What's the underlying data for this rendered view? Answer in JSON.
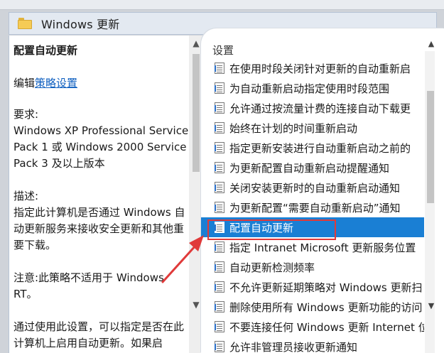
{
  "header": {
    "title": "Windows 更新",
    "folder_icon": "folder-icon"
  },
  "left_pane": {
    "policy_title": "配置自动更新",
    "edit_prefix": "编辑",
    "edit_link": "策略设置",
    "requirements_label": "要求:",
    "requirements_text": "Windows XP Professional Service Pack 1 或 Windows 2000 Service Pack 3 及以上版本",
    "description_label": "描述:",
    "description_text": "指定此计算机是否通过 Windows 自动更新服务来接收安全更新和其他重要下载。",
    "note_text": "注意:此策略不适用于 Windows RT。",
    "usage_text": "通过使用此设置，可以指定是否在此计算机上启用自动更新。如果启"
  },
  "right_pane": {
    "column_header": "设置",
    "selected_index": 8,
    "settings": [
      "在使用时段关闭针对更新的自动重新启",
      "为自动重新启动指定使用时段范围",
      "允许通过按流量计费的连接自动下载更",
      "始终在计划的时间重新启动",
      "指定更新安装进行自动重新启动之前的",
      "为更新配置自动重新启动提醒通知",
      "关闭安装更新时的自动重新启动通知",
      "为更新配置“需要自动重新启动”通知",
      "配置自动更新",
      "指定 Intranet Microsoft 更新服务位置",
      "自动更新检测频率",
      "不允许更新延期策略对 Windows 更新扫",
      "删除使用所有 Windows 更新功能的访问",
      "不要连接任何 Windows 更新 Internet 位",
      "允许非管理员接收更新通知"
    ]
  },
  "annotations": {
    "highlight_color": "#e03a3a",
    "arrow_color": "#e03a3a"
  },
  "scrollbars": {
    "up_arrow": "▲",
    "down_arrow": "▼"
  },
  "colors": {
    "selection": "#1a7fd4",
    "link": "#1060c0"
  }
}
